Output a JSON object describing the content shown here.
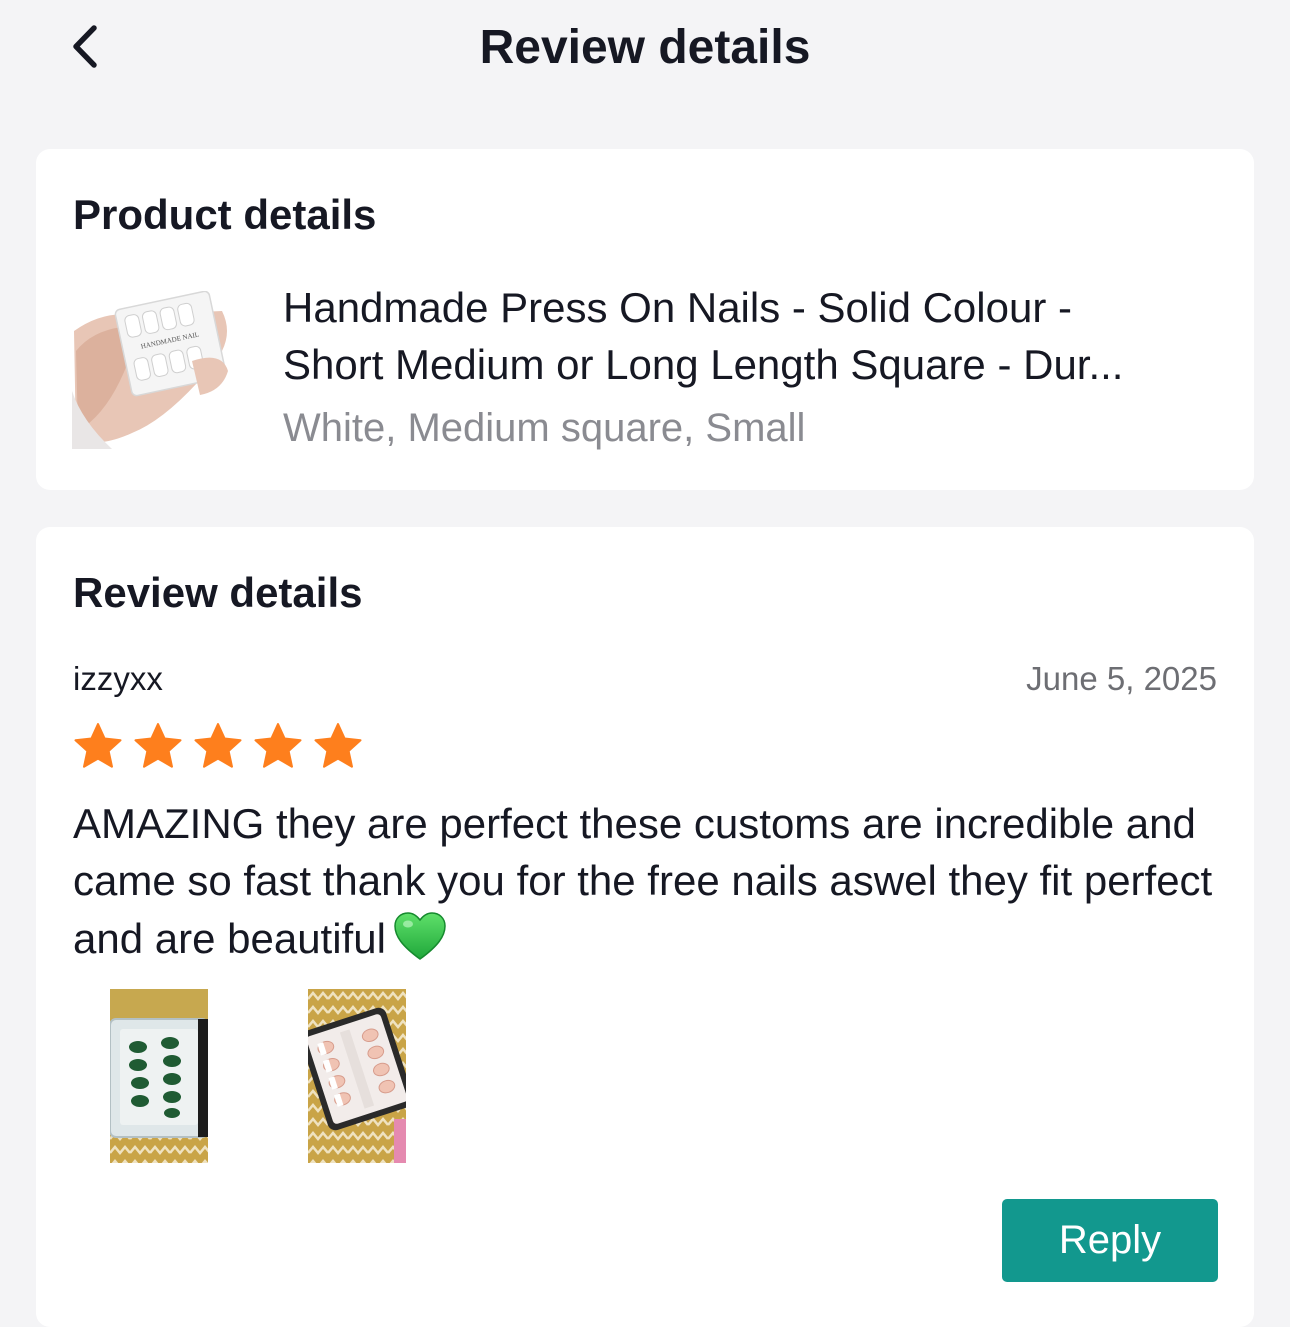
{
  "header": {
    "title": "Review details",
    "back_icon": "chevron-left-icon"
  },
  "product_section": {
    "title": "Product details",
    "product": {
      "name_line1": "Handmade Press On Nails - Solid Colour -",
      "name_line2": "Short Medium or Long Length Square - Dur...",
      "variant": "White, Medium square, Small",
      "thumbnail_icon": "product-thumbnail",
      "thumbnail_label": "HANDMADE NAIL"
    }
  },
  "review_section": {
    "title": "Review details",
    "reviewer": "izzyxx",
    "date": "June 5, 2025",
    "rating": 5,
    "rating_max": 5,
    "star_color": "#fe7f1d",
    "text": "AMAZING they are perfect these customs are incredible and came so fast thank you for the free nails aswel they fit perfect and are beautiful",
    "emoji": "green-heart",
    "photos": [
      "review-photo-green-nails",
      "review-photo-french-nails"
    ],
    "reply_label": "Reply",
    "accent_color": "#12988e"
  }
}
